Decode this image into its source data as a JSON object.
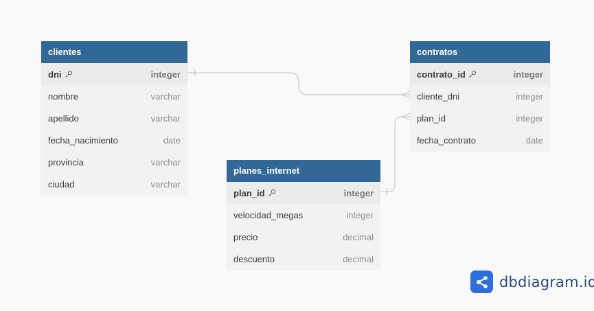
{
  "tables": {
    "clientes": {
      "title": "clientes",
      "fields": [
        {
          "name": "dni",
          "type": "integer",
          "pk": true
        },
        {
          "name": "nombre",
          "type": "varchar"
        },
        {
          "name": "apellido",
          "type": "varchar"
        },
        {
          "name": "fecha_nacimiento",
          "type": "date"
        },
        {
          "name": "provincia",
          "type": "varchar"
        },
        {
          "name": "ciudad",
          "type": "varchar"
        }
      ]
    },
    "contratos": {
      "title": "contratos",
      "fields": [
        {
          "name": "contrato_id",
          "type": "integer",
          "pk": true
        },
        {
          "name": "cliente_dni",
          "type": "integer"
        },
        {
          "name": "plan_id",
          "type": "integer"
        },
        {
          "name": "fecha_contrato",
          "type": "date"
        }
      ]
    },
    "planes_internet": {
      "title": "planes_internet",
      "fields": [
        {
          "name": "plan_id",
          "type": "integer",
          "pk": true
        },
        {
          "name": "velocidad_megas",
          "type": "integer"
        },
        {
          "name": "precio",
          "type": "decimal"
        },
        {
          "name": "descuento",
          "type": "decimal"
        }
      ]
    }
  },
  "brand": {
    "text": "dbdiagram.io",
    "logo_color": "#2f6fdc"
  },
  "colors": {
    "header": "#316896",
    "link": "#c9c9cc"
  }
}
